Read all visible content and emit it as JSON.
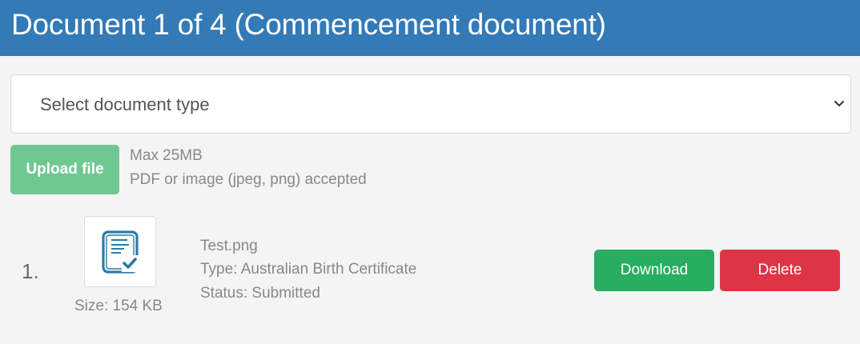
{
  "header": {
    "title": "Document 1 of 4 (Commencement document)"
  },
  "document_type_select": {
    "selected": "Select document type",
    "icon": "chevron-down-icon"
  },
  "upload": {
    "button_label": "Upload file",
    "hint_max_size": "Max 25MB",
    "hint_formats": "PDF or image (jpeg, png) accepted"
  },
  "files": [
    {
      "index": "1.",
      "icon": "certificate-document-icon",
      "size": "Size: 154 KB",
      "name": "Test.png",
      "type": "Type: Australian Birth Certificate",
      "status": "Status: Submitted",
      "download_label": "Download",
      "delete_label": "Delete"
    }
  ],
  "colors": {
    "header_bg": "#337ab7",
    "upload_button": "#6fc891",
    "download_button": "#27ae60",
    "delete_button": "#de3546",
    "icon_blue": "#2a7ca6"
  }
}
